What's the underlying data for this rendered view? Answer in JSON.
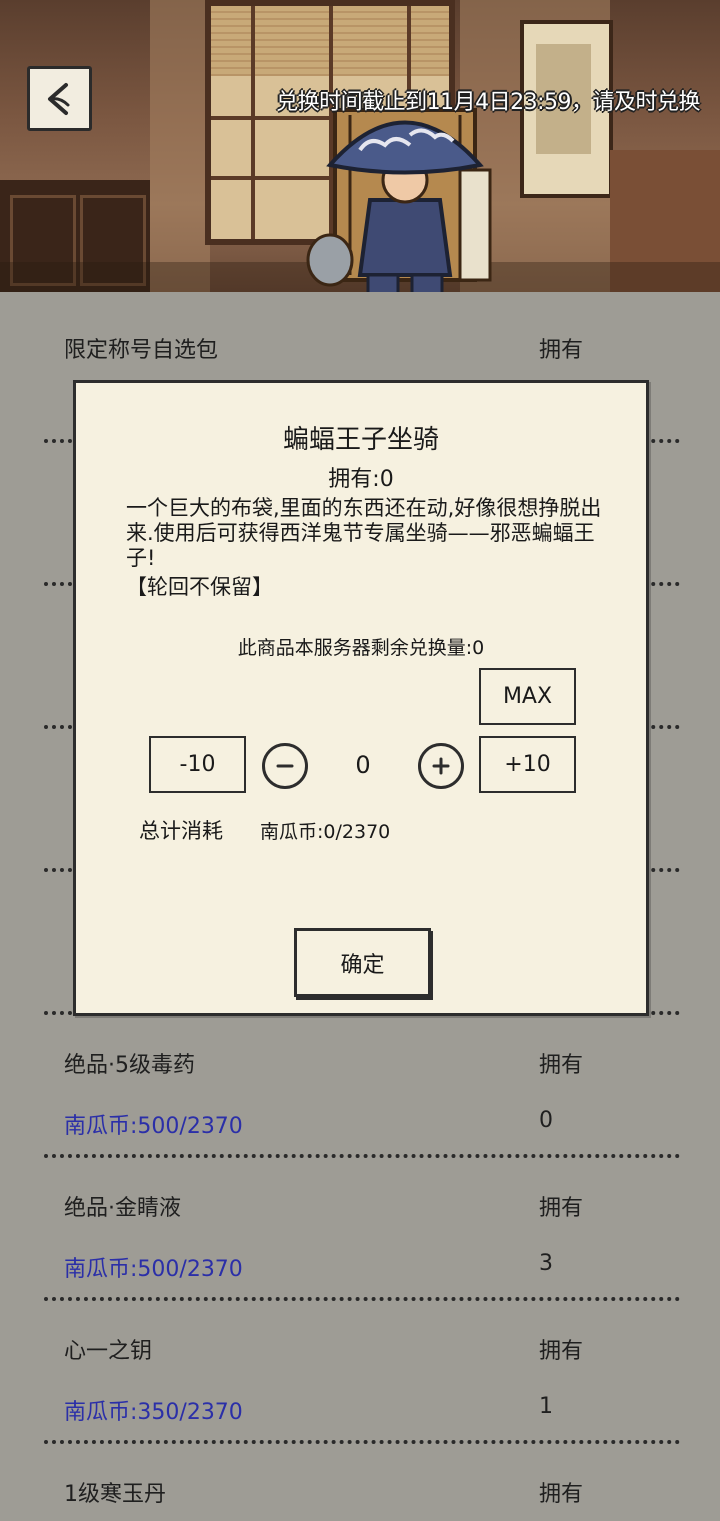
{
  "header": {
    "back_icon": "back-arrow-icon",
    "deadline": "兑换时间截止到11月4日23:59，请及时兑换"
  },
  "list": [
    {
      "name": "限定称号自选包",
      "own_label": "拥有",
      "price": "",
      "count": ""
    },
    {
      "name": "",
      "own_label": "",
      "price": "",
      "count": ""
    },
    {
      "name": "",
      "own_label": "",
      "price": "",
      "count": ""
    },
    {
      "name": "",
      "own_label": "",
      "price": "",
      "count": ""
    },
    {
      "name": "",
      "own_label": "",
      "price": "",
      "count": ""
    },
    {
      "name": "绝品·5级毒药",
      "own_label": "拥有",
      "price": "南瓜币:500/2370",
      "count": "0"
    },
    {
      "name": "绝品·金睛液",
      "own_label": "拥有",
      "price": "南瓜币:500/2370",
      "count": "3"
    },
    {
      "name": "心一之钥",
      "own_label": "拥有",
      "price": "南瓜币:350/2370",
      "count": "1"
    },
    {
      "name": "1级寒玉丹",
      "own_label": "拥有",
      "price": "",
      "count": ""
    }
  ],
  "modal": {
    "title": "蝙蝠王子坐骑",
    "owned": "拥有:0",
    "description": "一个巨大的布袋,里面的东西还在动,好像很想挣脱出来.使用后可获得西洋鬼节专属坐骑——邪恶蝙蝠王子!",
    "note": "【轮回不保留】",
    "remaining": "此商品本服务器剩余兑换量:0",
    "max_label": "MAX",
    "minus10_label": "-10",
    "plus10_label": "+10",
    "quantity": "0",
    "total_label": "总计消耗",
    "total_value": "南瓜币:0/2370",
    "confirm_label": "确定"
  },
  "colors": {
    "modal_bg": "#f6f1e0",
    "list_bg": "#9e9c95",
    "price_text": "#2b2fa8"
  }
}
